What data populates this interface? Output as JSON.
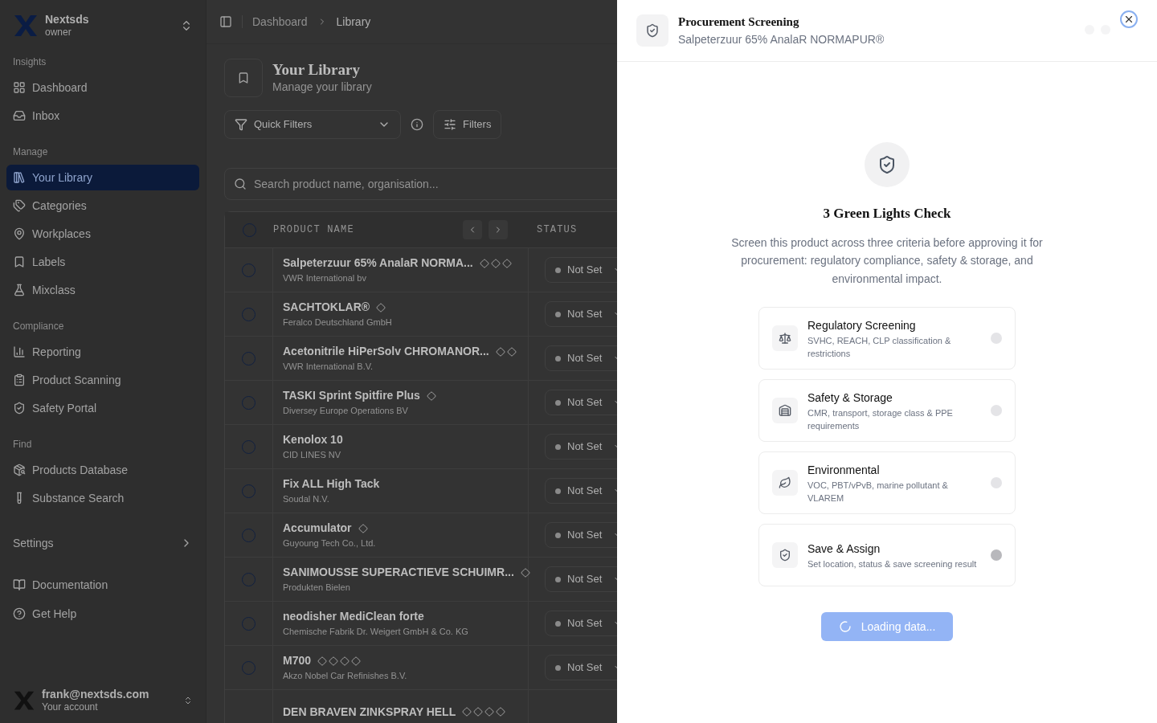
{
  "workspace": {
    "name": "Nextsds",
    "role": "owner"
  },
  "sidebar": {
    "sections": [
      {
        "title": "Insights",
        "items": [
          {
            "label": "Dashboard",
            "selected": false
          },
          {
            "label": "Inbox",
            "selected": false
          }
        ]
      },
      {
        "title": "Manage",
        "items": [
          {
            "label": "Your Library",
            "selected": true
          },
          {
            "label": "Categories",
            "selected": false
          },
          {
            "label": "Workplaces",
            "selected": false
          },
          {
            "label": "Labels",
            "selected": false
          },
          {
            "label": "Mixclass",
            "selected": false
          }
        ]
      },
      {
        "title": "Compliance",
        "items": [
          {
            "label": "Reporting",
            "selected": false
          },
          {
            "label": "Product Scanning",
            "selected": false
          },
          {
            "label": "Safety Portal",
            "selected": false
          }
        ]
      },
      {
        "title": "Find",
        "items": [
          {
            "label": "Products Database",
            "selected": false
          },
          {
            "label": "Substance Search",
            "selected": false
          }
        ]
      }
    ],
    "settings": {
      "label": "Settings",
      "expanded": false
    },
    "footer_items": [
      {
        "label": "Documentation",
        "selected": false
      },
      {
        "label": "Get Help",
        "selected": false
      }
    ],
    "account": {
      "email": "frank@nextsds.com",
      "caption": "Your account"
    }
  },
  "breadcrumb": [
    "Dashboard",
    "Library"
  ],
  "page": {
    "title": "Your Library",
    "subtitle": "Manage your library"
  },
  "toolbar": {
    "quick_filters": "Quick Filters",
    "filters": "Filters"
  },
  "search": {
    "placeholder": "Search product name, organisation..."
  },
  "table": {
    "columns": [
      "PRODUCT NAME",
      "STATUS"
    ],
    "header_checked": false,
    "rows": [
      {
        "name": "Salpeterzuur 65% AnalaR NORMA...",
        "organisation": "VWR International bv",
        "pictograms": [
          {
            "kind": "ghs"
          },
          {
            "kind": "ghs"
          },
          {
            "kind": "ghs"
          }
        ],
        "status": "Not Set",
        "checked": false
      },
      {
        "name": "SACHTOKLAR®",
        "organisation": "Feralco Deutschland GmbH",
        "pictograms": [
          {
            "kind": "ghs"
          }
        ],
        "status": "Not Set",
        "checked": false
      },
      {
        "name": "Acetonitrile HiPerSolv CHROMANOR...",
        "organisation": "VWR International B.V.",
        "pictograms": [
          {
            "kind": "ghs"
          },
          {
            "kind": "ghs"
          }
        ],
        "status": "Not Set",
        "checked": false
      },
      {
        "name": "TASKI Sprint Spitfire Plus",
        "organisation": "Diversey Europe Operations BV",
        "pictograms": [
          {
            "kind": "ghs"
          }
        ],
        "status": "Not Set",
        "checked": false
      },
      {
        "name": "Kenolox 10",
        "organisation": "CID LINES NV",
        "pictograms": [],
        "status": "Not Set",
        "checked": false
      },
      {
        "name": "Fix ALL High Tack",
        "organisation": "Soudal N.V.",
        "pictograms": [],
        "status": "Not Set",
        "checked": false
      },
      {
        "name": "Accumulator",
        "organisation": "Guyoung Tech Co., Ltd.",
        "pictograms": [
          {
            "kind": "ghs"
          }
        ],
        "status": "Not Set",
        "checked": false
      },
      {
        "name": "SANIMOUSSE SUPERACTIEVE SCHUIMR...",
        "organisation": "Produkten Bielen",
        "pictograms": [
          {
            "kind": "ghs"
          }
        ],
        "status": "Not Set",
        "checked": false
      },
      {
        "name": "neodisher MediClean forte",
        "organisation": "Chemische Fabrik Dr. Weigert GmbH & Co. KG",
        "pictograms": [],
        "status": "Not Set",
        "checked": false
      },
      {
        "name": "M700",
        "organisation": "Akzo Nobel Car Refinishes B.V.",
        "pictograms": [
          {
            "kind": "ghs"
          },
          {
            "kind": "ghs"
          },
          {
            "kind": "ghs"
          },
          {
            "kind": "ghs"
          }
        ],
        "status": "Not Set",
        "checked": false
      },
      {
        "name": "DEN BRAVEN ZINKSPRAY HELL",
        "pictograms": [
          {
            "kind": "ghs"
          },
          {
            "kind": "ghs"
          },
          {
            "kind": "ghs"
          },
          {
            "kind": "ghs"
          }
        ]
      }
    ]
  },
  "drawer": {
    "title": "Procurement Screening",
    "subtitle": "Salpeterzuur 65% AnalaR NORMAPUR®",
    "heading": "3 Green Lights Check",
    "description": "Screen this product across three criteria before approving it for procurement: regulatory compliance, safety & storage, and environmental impact.",
    "steps": [
      {
        "title": "Regulatory Screening",
        "detail": "SVHC, REACH, CLP classification & restrictions",
        "active": false
      },
      {
        "title": "Safety & Storage",
        "detail": "CMR, transport, storage class & PPE requirements",
        "active": false
      },
      {
        "title": "Environmental",
        "detail": "VOC, PBT/vPvB, marine pollutant & VLAREM",
        "active": false
      },
      {
        "title": "Save & Assign",
        "detail": "Set location, status & save screening result",
        "active": true
      }
    ],
    "button": {
      "label": "Loading data...",
      "loading": true
    }
  }
}
